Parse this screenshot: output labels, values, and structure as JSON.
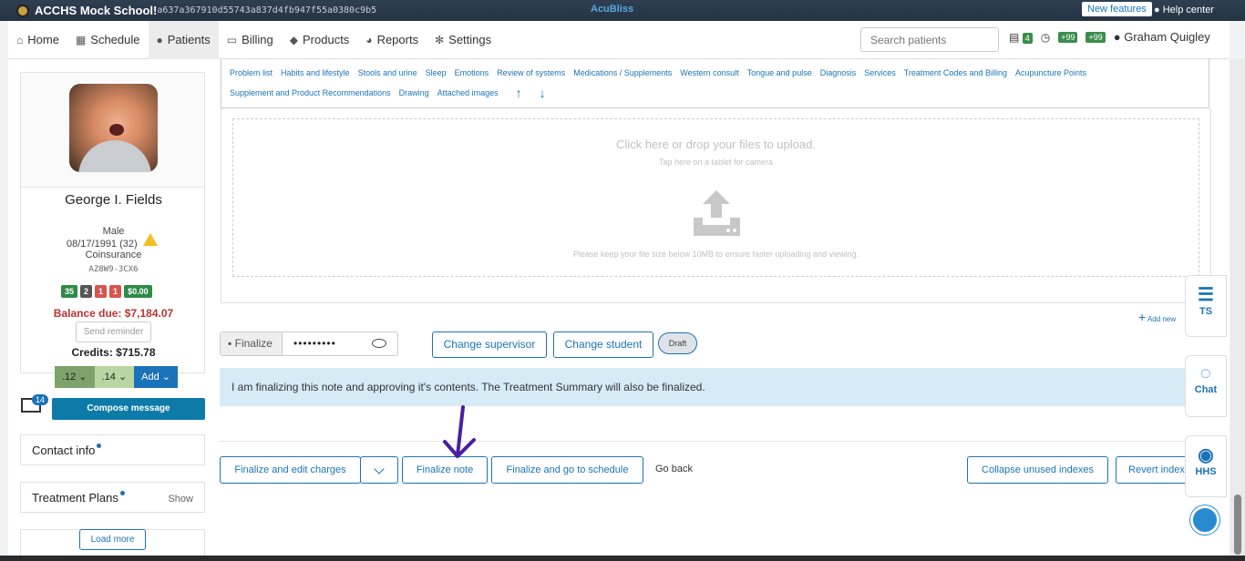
{
  "titlebar": {
    "school": "ACCHS Mock School!",
    "hash": "a637a367910d55743a837d4fb947f55a0380c9b5",
    "brand": "AcuBliss",
    "new_features": "New features",
    "help_center": "Help center"
  },
  "nav": {
    "items": [
      {
        "label": "Home",
        "icon": "home-icon"
      },
      {
        "label": "Schedule",
        "icon": "calendar-icon"
      },
      {
        "label": "Patients",
        "icon": "user-icon"
      },
      {
        "label": "Billing",
        "icon": "billing-icon"
      },
      {
        "label": "Products",
        "icon": "cube-icon"
      },
      {
        "label": "Reports",
        "icon": "pie-chart-icon"
      },
      {
        "label": "Settings",
        "icon": "gear-icon"
      }
    ],
    "search_placeholder": "Search patients",
    "badge_msgs": "4",
    "badge_a": "+99",
    "badge_b": "+99",
    "user": "Graham Quigley"
  },
  "patient": {
    "name": "George I. Fields",
    "gender": "Male",
    "dob": "08/17/1991 (32)",
    "insurance": "Coinsurance",
    "code": "AZ8W9-3CX6",
    "chips": [
      {
        "text": "35",
        "color": "#2e8b47"
      },
      {
        "text": "2",
        "color": "#555555"
      },
      {
        "text": "1",
        "color": "#d9534f"
      },
      {
        "text": "1",
        "color": "#d9534f"
      },
      {
        "text": "$0.00",
        "color": "#2e8b47"
      }
    ],
    "balance": "Balance due: $7,184.07",
    "send_reminder": "Send reminder",
    "credits": "Credits: $715.78",
    "btn_12": ".12",
    "btn_14": ".14",
    "btn_add": "Add"
  },
  "messages": {
    "count": "14",
    "compose": "Compose message"
  },
  "sections": {
    "contact": "Contact info",
    "plans": "Treatment Plans",
    "plans_show": "Show",
    "load_more": "Load more"
  },
  "tabs": [
    "Problem list",
    "Habits and lifestyle",
    "Stools and urine",
    "Sleep",
    "Emotions",
    "Review of systems",
    "Medications / Supplements",
    "Western consult",
    "Tongue and pulse",
    "Diagnosis",
    "Services",
    "Treatment Codes and Billing",
    "Acupuncture Points",
    "Supplement and Product Recommendations",
    "Drawing",
    "Attached images"
  ],
  "upload": {
    "title": "Click here or drop your files to upload.",
    "subtitle": "Tap here on a tablet for camera",
    "note": "Please keep your file size below 10MB to ensure faster uploading and viewing."
  },
  "add_new": "Add new",
  "finalize": {
    "label": "Finalize",
    "password": "•••••••••",
    "change_supervisor": "Change supervisor",
    "change_student": "Change student",
    "draft": "Draft",
    "notice": "I am finalizing this note and approving it's contents. The Treatment Summary will also be finalized."
  },
  "actions": {
    "finalize_edit": "Finalize and edit charges",
    "finalize_note": "Finalize note",
    "finalize_schedule": "Finalize and go to schedule",
    "go_back": "Go back",
    "collapse": "Collapse unused indexes",
    "revert": "Revert index"
  },
  "float": {
    "ts": "TS",
    "chat": "Chat",
    "hhs": "HHS"
  }
}
